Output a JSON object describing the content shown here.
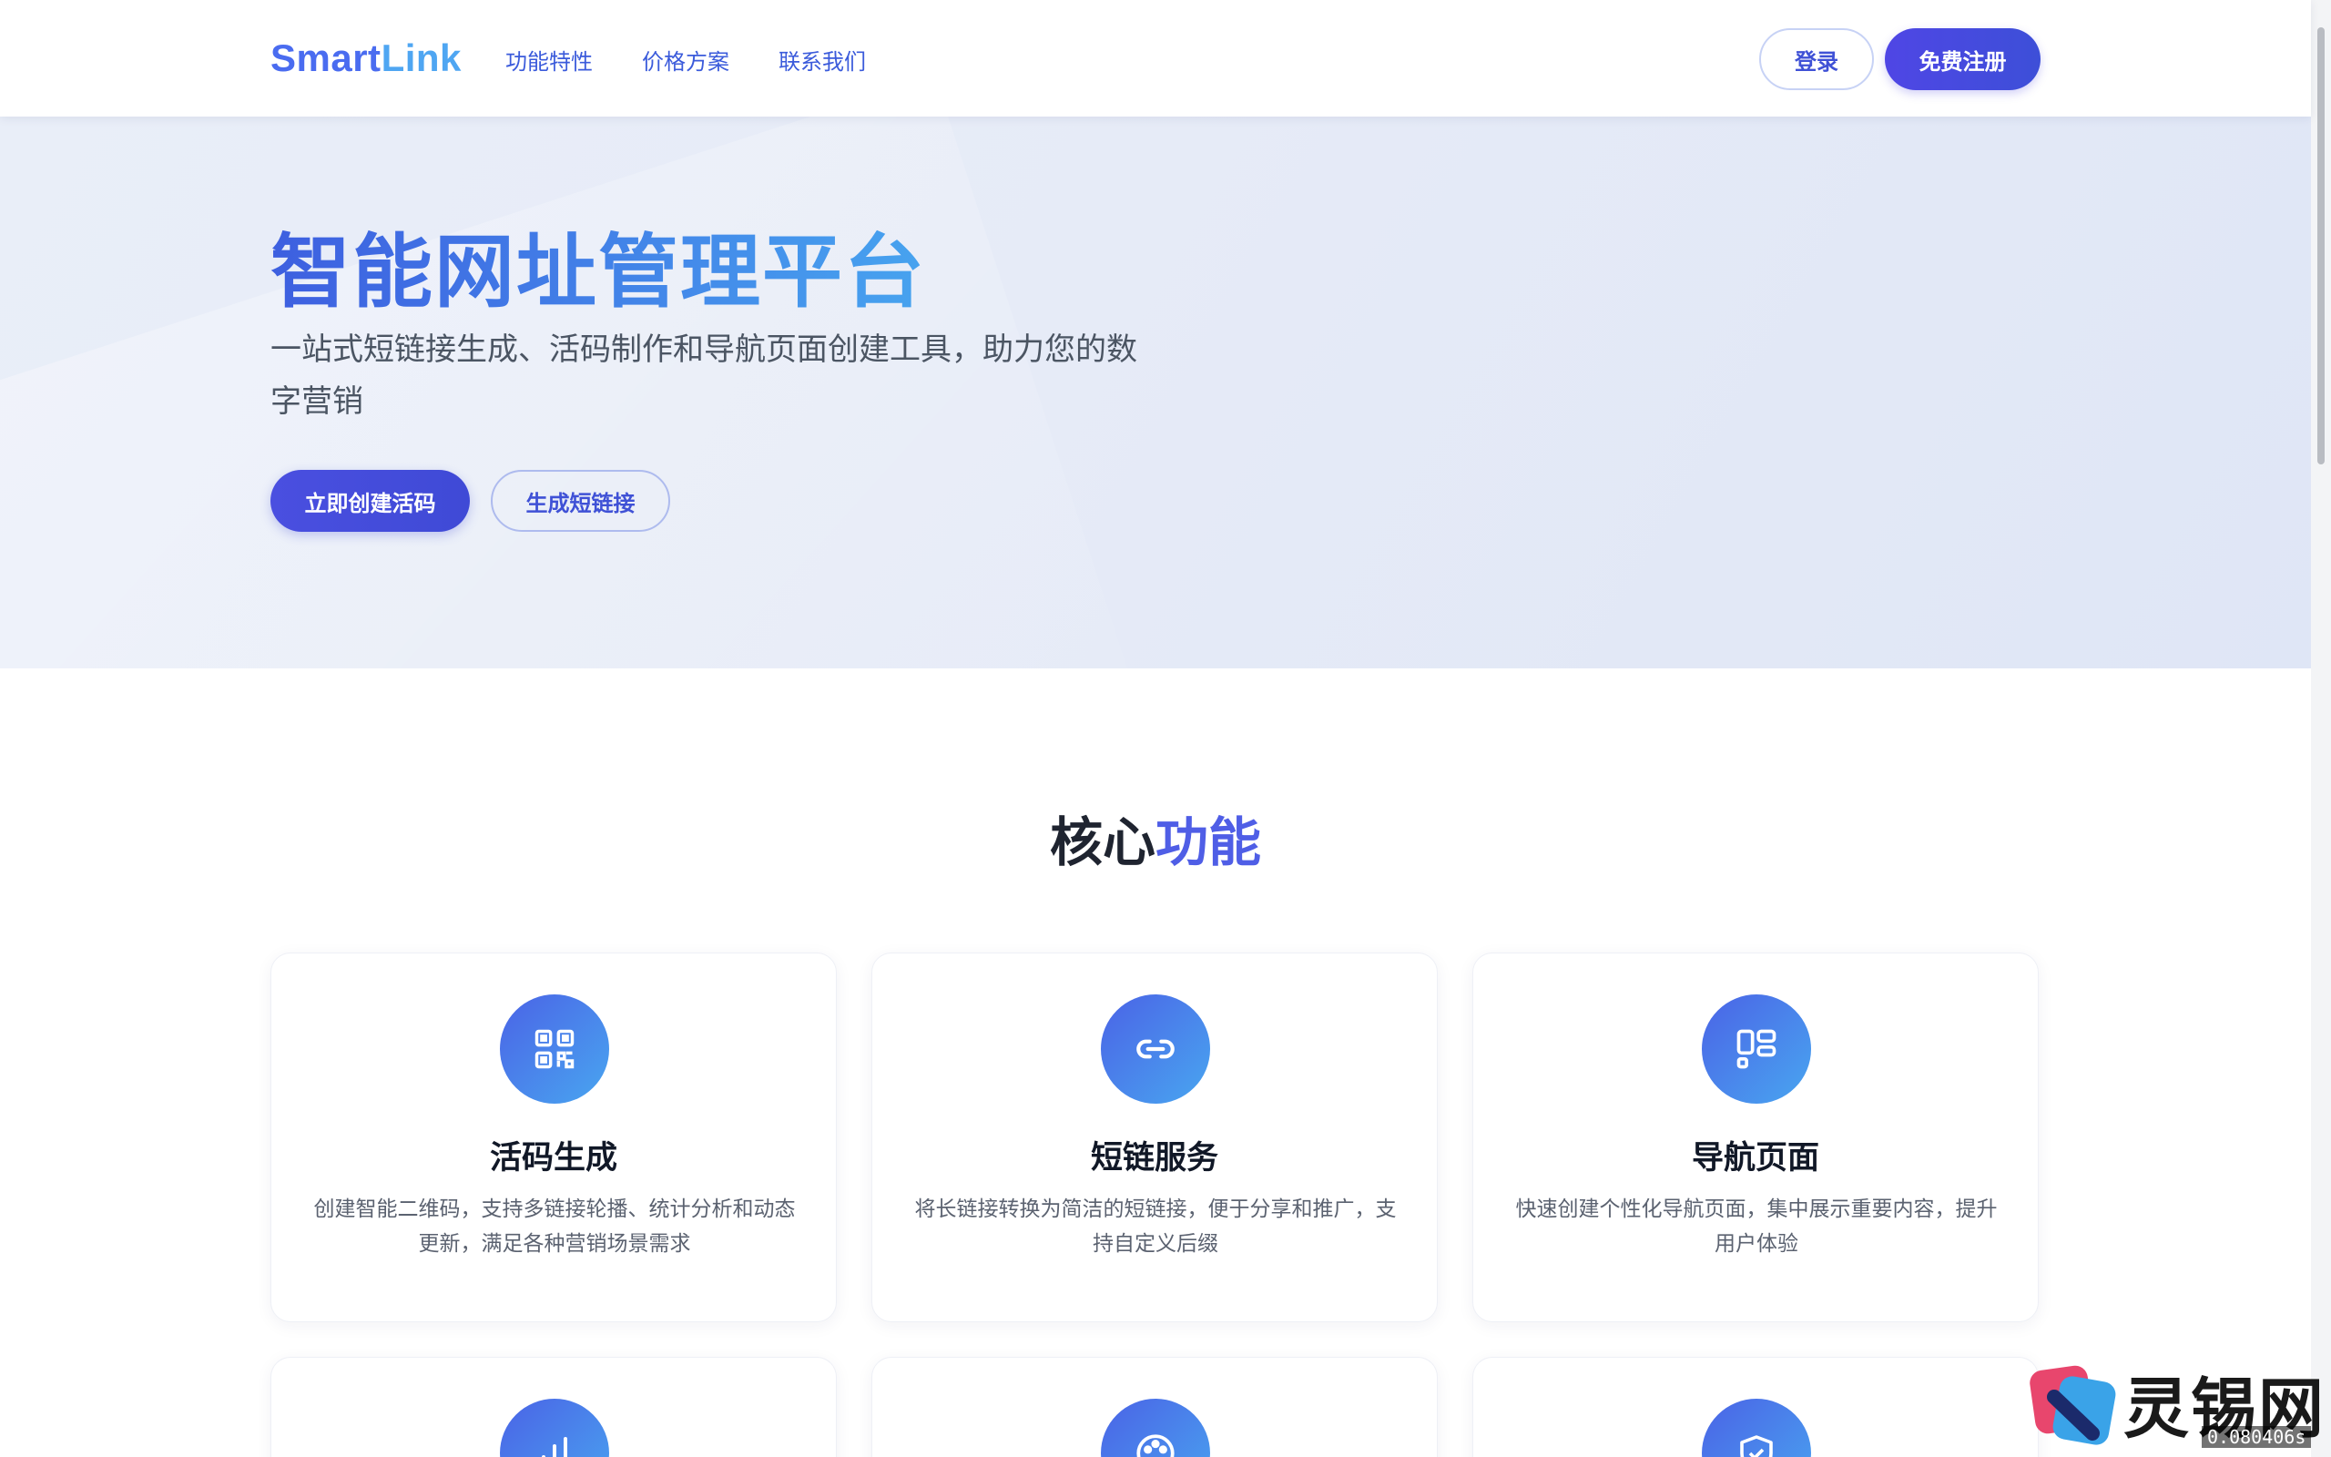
{
  "header": {
    "logo_part1": "Smart",
    "logo_part2": "Link",
    "nav": [
      "功能特性",
      "价格方案",
      "联系我们"
    ],
    "login_label": "登录",
    "register_label": "免费注册"
  },
  "hero": {
    "title": "智能网址管理平台",
    "subtitle": "一站式短链接生成、活码制作和导航页面创建工具，助力您的数字营销",
    "primary_cta": "立即创建活码",
    "secondary_cta": "生成短链接"
  },
  "features": {
    "title_part1": "核心",
    "title_part2": "功能",
    "cards": [
      {
        "icon": "qrcode-icon",
        "title": "活码生成",
        "desc": "创建智能二维码，支持多链接轮播、统计分析和动态更新，满足各种营销场景需求"
      },
      {
        "icon": "link-icon",
        "title": "短链服务",
        "desc": "将长链接转换为简洁的短链接，便于分享和推广，支持自定义后缀"
      },
      {
        "icon": "layout-icon",
        "title": "导航页面",
        "desc": "快速创建个性化导航页面，集中展示重要内容，提升用户体验"
      }
    ],
    "more_icons": [
      "bar-chart-icon",
      "palette-icon",
      "shield-check-icon"
    ]
  },
  "watermark": {
    "text": "灵锡网",
    "timer": "0.080406s"
  },
  "colors": {
    "brand_blue": "#4a6cf0",
    "brand_light_blue": "#4fa6f2",
    "primary_button": "#4a4fe0",
    "hero_background": "#e6ebf7"
  }
}
